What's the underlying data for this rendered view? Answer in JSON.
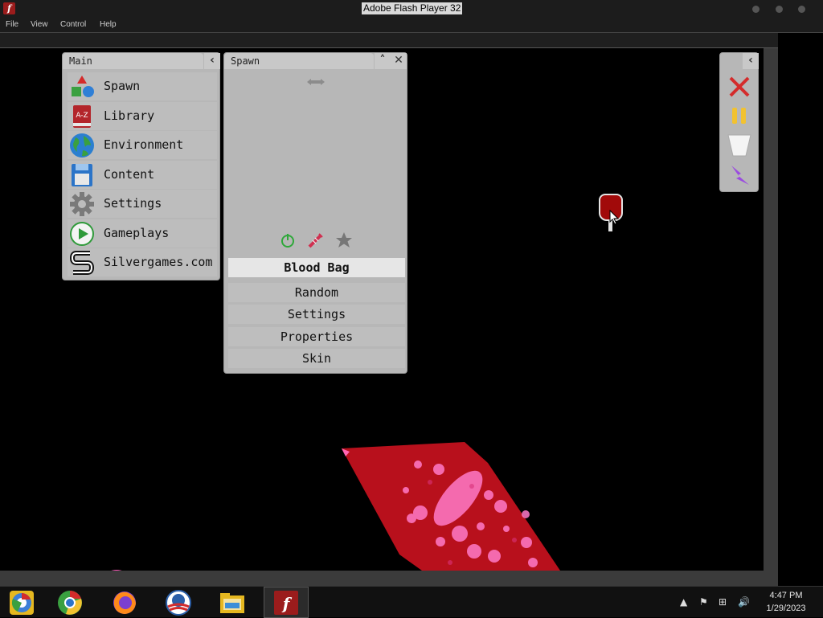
{
  "window": {
    "title": "Adobe Flash Player 32"
  },
  "menu": [
    "File",
    "View",
    "Control",
    "Help"
  ],
  "main_panel": {
    "title": "Main",
    "items": [
      {
        "label": "Spawn",
        "icon": "shapes-icon"
      },
      {
        "label": "Library",
        "icon": "book-icon"
      },
      {
        "label": "Environment",
        "icon": "globe-icon"
      },
      {
        "label": "Content",
        "icon": "floppy-disk-icon"
      },
      {
        "label": "Settings",
        "icon": "gear-icon"
      },
      {
        "label": "Gameplays",
        "icon": "play-icon"
      },
      {
        "label": "Silvergames.com",
        "icon": "silvergames-logo-icon"
      }
    ]
  },
  "spawn_panel": {
    "title": "Spawn",
    "selected": "Blood Bag",
    "buttons": [
      "Random",
      "Settings",
      "Properties",
      "Skin"
    ]
  },
  "taskbar": {
    "time": "4:47 PM",
    "date": "1/29/2023",
    "apps": [
      "chrome-canary-icon",
      "chrome-icon",
      "firefox-icon",
      "obama-logo-icon",
      "file-explorer-icon",
      "flash-player-icon"
    ]
  },
  "colors": {
    "panel": "#b7b7b7",
    "blood": "#b8101c",
    "highlight": "#e6e6e6"
  }
}
